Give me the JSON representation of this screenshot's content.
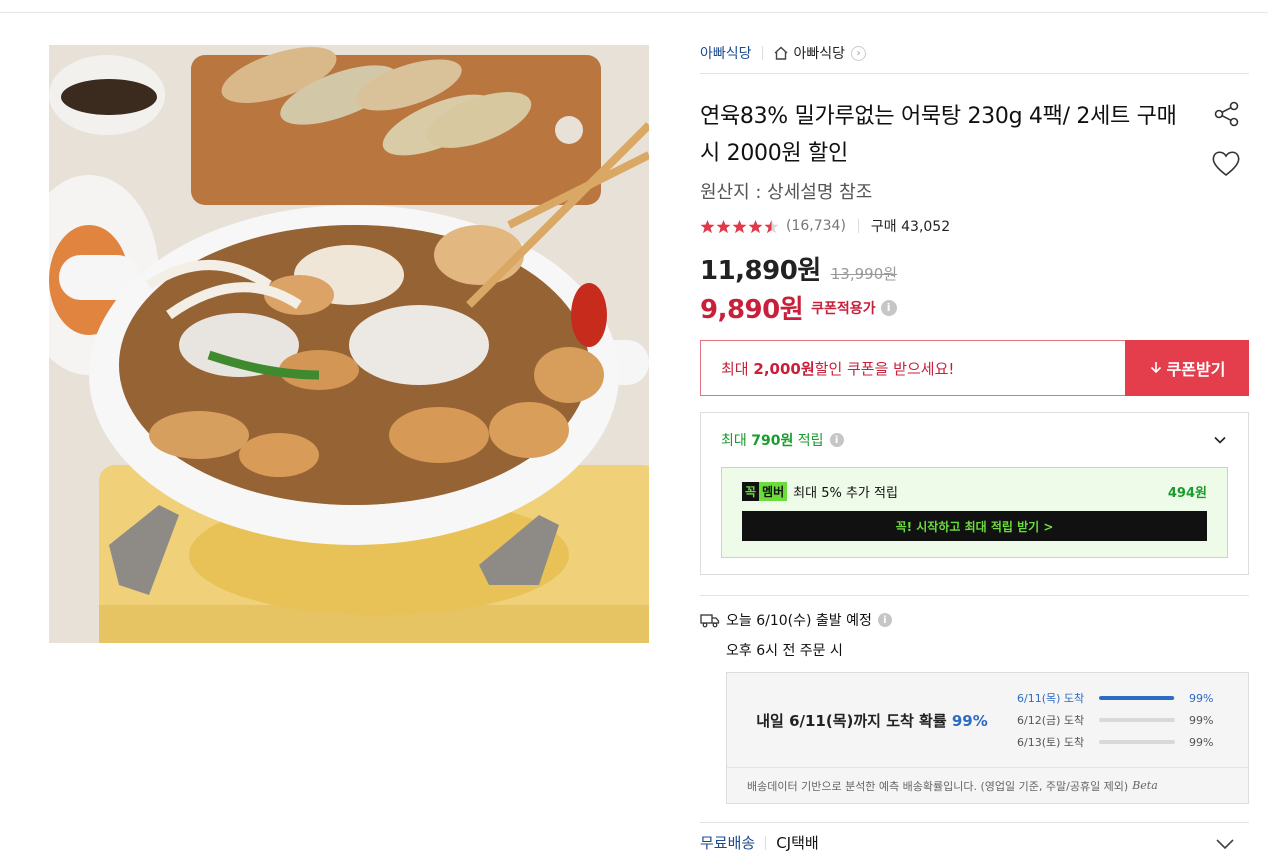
{
  "breadcrumb": {
    "store": "아빠식당",
    "home_label": "아빠식당"
  },
  "product": {
    "title": "연육83% 밀가루없는 어묵탕 230g 4팩/ 2세트 구매 시 2000원 할인",
    "origin": "원산지 : 상세설명 참조",
    "rating": 4.5,
    "review_count": "(16,734)",
    "purchase_count": "구매 43,052",
    "price": "11,890원",
    "original_price": "13,990원",
    "coupon_price": "9,890원",
    "coupon_price_label": "쿠폰적용가"
  },
  "coupon": {
    "message_prefix": "최대 ",
    "message_amount": "2,000원",
    "message_suffix": " 할인 쿠폰을 받으세요!",
    "button_label": "쿠폰받기"
  },
  "points": {
    "prefix": "최대 ",
    "amount": "790원",
    "suffix": " 적립",
    "member_badge_1": "꼭",
    "member_badge_2": "멤버",
    "member_text": "최대 5% 추가 적립",
    "member_amount": "494원",
    "member_cta": "꼭! 시작하고 최대 적립 받기 >"
  },
  "delivery": {
    "dispatch": "오늘 6/10(수) 출발 예정",
    "cutoff": "오후 6시 전 주문 시",
    "arrival_text_1": "내일 6/11(목)까지 도착 확률 ",
    "arrival_pct": "99%",
    "probabilities": [
      {
        "date": "6/11(목) 도착",
        "value": 0.99,
        "label": "99%",
        "color": "#2d6bc4"
      },
      {
        "date": "6/12(금) 도착",
        "value": 0.99,
        "label": "99%",
        "color": "#d9d9d9"
      },
      {
        "date": "6/13(토) 도착",
        "value": 0.99,
        "label": "99%",
        "color": "#d9d9d9"
      }
    ],
    "note": "배송데이터 기반으로 분석한 예측 배송확률입니다. (영업일 기준, 주말/공휴일 제외)",
    "beta": "Beta"
  },
  "shipping": {
    "free": "무료배송",
    "carrier": "CJ택배"
  },
  "colors": {
    "accent_red": "#c8203a",
    "button_red": "#e43d4c",
    "green": "#1a9b2e",
    "blue": "#2d6bc4"
  },
  "icons": [
    "home-icon",
    "share-icon",
    "heart-icon",
    "star-icon",
    "info-icon",
    "download-icon",
    "chevron-down-icon",
    "truck-icon"
  ]
}
